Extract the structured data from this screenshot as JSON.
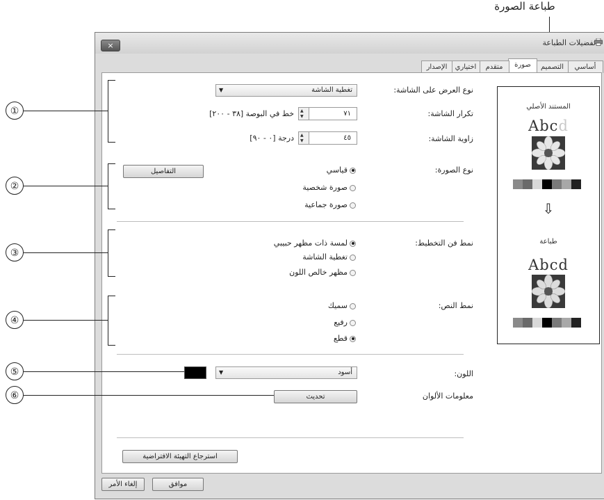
{
  "callout_top_label": "طباعة الصورة",
  "window": {
    "title": "تفضيلات الطباعة",
    "close": "×"
  },
  "tabs": [
    {
      "label": "أساسي",
      "active": false
    },
    {
      "label": "التصميم",
      "active": false
    },
    {
      "label": "صورة",
      "active": true
    },
    {
      "label": "متقدم",
      "active": false
    },
    {
      "label": "اختياري",
      "active": false
    },
    {
      "label": "الإصدار",
      "active": false
    }
  ],
  "screen_type": {
    "label": "نوع العرض على الشاشة:",
    "value": "تغطية الشاشة"
  },
  "screen_frequency": {
    "label": "تكرار الشاشة:",
    "value": "٧١",
    "unit": "خط في البوصة [٣٨ - ٢٠٠]"
  },
  "screen_angle": {
    "label": "زاوية الشاشة:",
    "value": "٤٥",
    "unit": "درجة [٠ - ٩٠]"
  },
  "image_type": {
    "label": "نوع الصورة:",
    "details_button": "التفاصيل",
    "options": [
      {
        "label": "قياسي",
        "selected": true
      },
      {
        "label": "صورة شخصية",
        "selected": false
      },
      {
        "label": "صورة جماعية",
        "selected": false
      }
    ]
  },
  "shading_pattern": {
    "label": "نمط فن التخطيط:",
    "options": [
      {
        "label": "لمسة ذات مظهر حبيبي",
        "selected": true
      },
      {
        "label": "تغطية الشاشة",
        "selected": false
      },
      {
        "label": "مظهر خالص اللون",
        "selected": false
      }
    ]
  },
  "text_pattern": {
    "label": "نمط النص:",
    "options": [
      {
        "label": "سميك",
        "selected": false
      },
      {
        "label": "رفيع",
        "selected": false
      },
      {
        "label": "قطع",
        "selected": true
      }
    ]
  },
  "color": {
    "label": "اللون:",
    "value": "أسود",
    "swatch": "#000000"
  },
  "color_info": {
    "label": "معلومات الألوان",
    "update_button": "تحديث"
  },
  "restore_defaults_button": "استرجاع التهيئة الافتراضية",
  "ok_button": "موافق",
  "cancel_button": "إلغاء الأمر",
  "preview": {
    "original_label": "المستند الأصلي",
    "original_text": "Abc",
    "original_text_faded": "d",
    "print_label": "طباعة",
    "print_text": "Abcd",
    "arrow": "⇩",
    "original_swatches": [
      "#8a8a8a",
      "#6a6a6a",
      "#d8d8d8",
      "#000000",
      "#7a7a7a",
      "#a8a8a8",
      "#222222"
    ],
    "print_swatches": [
      "#8a8a8a",
      "#6a6a6a",
      "#d8d8d8",
      "#000000",
      "#7a7a7a",
      "#a8a8a8",
      "#222222"
    ]
  },
  "callouts": [
    "①",
    "②",
    "③",
    "④",
    "⑤",
    "⑥"
  ]
}
